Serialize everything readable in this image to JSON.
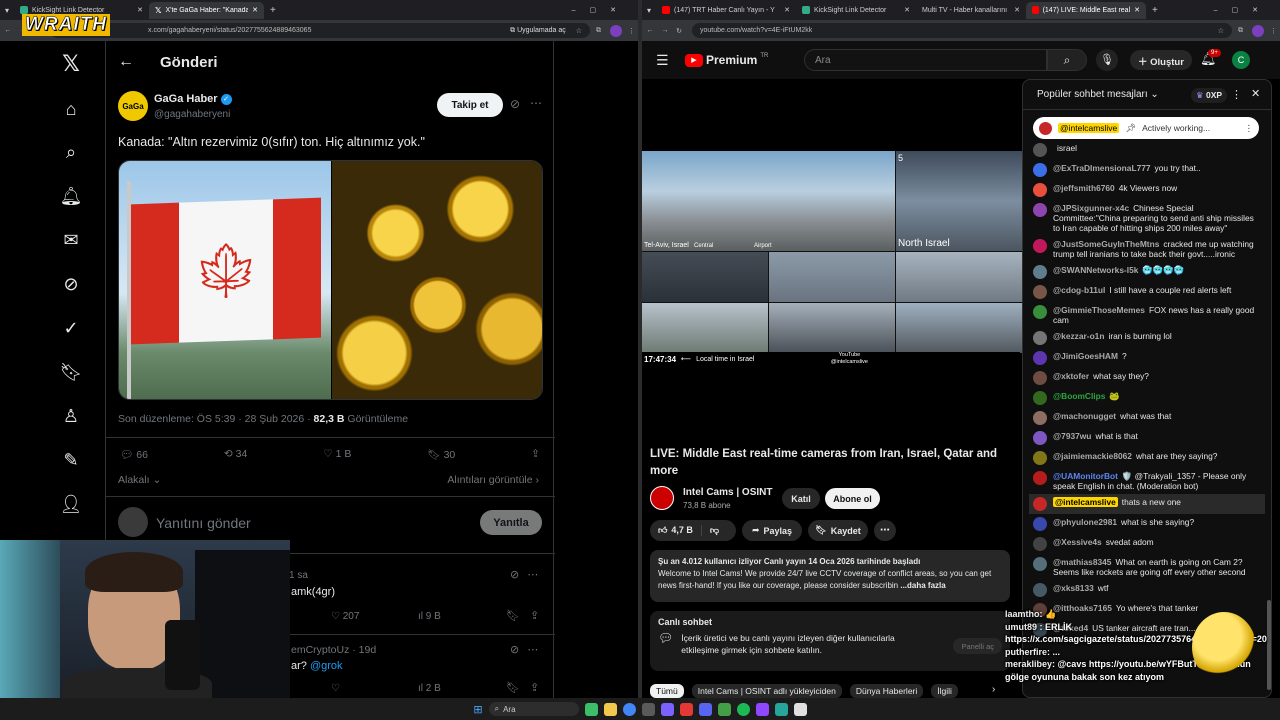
{
  "left_browser": {
    "tabs": [
      {
        "label": "KickSight Link Detector",
        "active": false
      },
      {
        "label": "X'te GaGa Haber: \"Kanada: \"Altı",
        "active": true
      }
    ],
    "url": "x.com/gagahaberyeni/status/2027755624889463065",
    "open_in_app": "Uygulamada aç"
  },
  "right_browser": {
    "tabs": [
      {
        "label": "(147) TRT Haber Canlı Yayın - Y",
        "active": false
      },
      {
        "label": "KickSight Link Detector",
        "active": false
      },
      {
        "label": "Multi TV - Haber kanallarını",
        "active": false
      },
      {
        "label": "(147) LIVE: Middle East real",
        "active": true
      }
    ],
    "url": "youtube.com/watch?v=4E-iFtUM2kk"
  },
  "overlay_logo": "WRAITH",
  "x": {
    "header": "Gönderi",
    "author_name": "GaGa Haber",
    "author_handle": "@gagahaberyeni",
    "avatar_text": "GaGa",
    "follow": "Takip et",
    "post_text": "Kanada: \"Altın rezervimiz 0(sıfır) ton. Hiç altınımız yok.\"",
    "edited": "Son düzenleme: ÖS 5:39 · 28 Şub 2026 · ",
    "views_count": "82,3 B",
    "views_label": " Görüntüleme",
    "stats": {
      "replies": "66",
      "reposts": "34",
      "likes": "1 B",
      "bookmarks": "30"
    },
    "relevant": "Alakalı",
    "quotes": "Alıntıları görüntüle",
    "reply_placeholder": "Yanıtını gönder",
    "reply_button": "Yanıtla",
    "reply1": {
      "time": "1 sa",
      "text": "amk(4gr)",
      "likes": "207",
      "views": "9 B"
    },
    "reply2": {
      "name": "emCryptoUz · 19d",
      "text": "ar?",
      "mention": "@grok",
      "views": "2 B"
    }
  },
  "youtube": {
    "brand": "Premium",
    "brand_sup": "TR",
    "search_placeholder": "Ara",
    "create": "Oluştur",
    "notif_count": "9+",
    "account_initial": "C",
    "video_labels": {
      "time": "17:47:34",
      "local": "Local time in Israel",
      "telaviv": "Tel-Aviv, Israel",
      "central": "Central",
      "airport": "Airport",
      "north": "North Israel",
      "channel_tag": "YouTube @intelcamslive",
      "n5": "5"
    },
    "title": "LIVE: Middle East real-time cameras from Iran, Israel, Qatar and more",
    "channel": "Intel Cams | OSINT",
    "subs": "73,8 B abone",
    "join": "Katıl",
    "subscribe": "Abone ol",
    "likes": "4,7 B",
    "share": "Paylaş",
    "save": "Kaydet",
    "desc_head": "Şu an 4.012 kullanıcı izliyor  Canlı yayın 14 Oca 2026 tarihinde başladı",
    "desc_body": "Welcome to Intel Cams! We provide 24/7 live CCTV coverage of conflict areas, so you can get news first-hand! If you like our coverage, please consider subscribin",
    "desc_more": "...daha fazla",
    "live_chat_title": "Canlı sohbet",
    "live_chat_body": "İçerik üretici ve bu canlı yayını izleyen diğer kullanıcılarla etkileşime girmek için sohbete katılın.",
    "live_chat_btn": "Panelli aç",
    "chips": [
      "Tümü",
      "Intel Cams | OSINT adlı yükleyiciden",
      "Dünya Haberleri",
      "İlgili"
    ]
  },
  "chat": {
    "title": "Popüler sohbet mesajları",
    "points": "0XP",
    "pinned_user": "@intelcamslive",
    "pinned_text": "Actively working...",
    "messages": [
      {
        "user": "",
        "text": "israel",
        "color": "#555"
      },
      {
        "user": "@ExTraDImensionaL777",
        "text": "you try that..",
        "color": "#3b6ee8"
      },
      {
        "user": "@jeffsmith6760",
        "text": "4k Viewers now",
        "color": "#e8503b"
      },
      {
        "user": "@JPSixgunner-x4c",
        "text": "Chinese Special Committee:\"China preparing to send anti ship missiles to Iran capable of hitting ships 200 miles away\"",
        "color": "#8e44ad"
      },
      {
        "user": "@JustSomeGuyInTheMtns",
        "text": "cracked me up watching trump tell iranians to take back their govt.....ironic",
        "color": "#c2185b"
      },
      {
        "user": "@SWANNetworks-l5k",
        "text": "🥶🥶🥶🥶",
        "color": "#607d8b"
      },
      {
        "user": "@cdog-b11ul",
        "text": "I still have a couple red alerts left",
        "color": "#795548"
      },
      {
        "user": "@GimmieThoseMemes",
        "text": "FOX news has a really good cam",
        "color": "#388e3c"
      },
      {
        "user": "@kezzar-o1n",
        "text": "iran is burning lol",
        "color": "#757575"
      },
      {
        "user": "@JimiGoesHAM",
        "text": "?",
        "color": "#5e35b1"
      },
      {
        "user": "@xktofer",
        "text": "what say they?",
        "color": "#6d4c41"
      },
      {
        "user": "@BoomClips",
        "text": "🐸",
        "color": "#33691e",
        "highlight": "green"
      },
      {
        "user": "@machonugget",
        "text": "what was that",
        "color": "#8d6e63"
      },
      {
        "user": "@7937wu",
        "text": "what is that",
        "color": "#7e57c2"
      },
      {
        "user": "@jaimiemackie8062",
        "text": "what are they saying?",
        "color": "#827717"
      },
      {
        "user": "@UAMonitorBot",
        "text": "🛡️ @Trakyali_1357 - Please only speak English in chat. (Moderation bot)",
        "color": "#b71c1c",
        "highlight": "blue"
      },
      {
        "user": "@intelcamslive",
        "text": "thats a new one",
        "color": "#c62828",
        "highlight": "owner"
      },
      {
        "user": "@phyulone2981",
        "text": "what is she saying?",
        "color": "#3949ab"
      },
      {
        "user": "@Xessive4s",
        "text": "svedat adom",
        "color": "#424242"
      },
      {
        "user": "@mathias8345",
        "text": "What on earth is going on Cam 2? Seems like rockets are going off every other second",
        "color": "#546e7a"
      },
      {
        "user": "@xks8133",
        "text": "wtf",
        "color": "#455a64"
      },
      {
        "user": "@itthoaks7165",
        "text": "Yo where's that tanker",
        "color": "#5d4037"
      },
      {
        "user": "@toked4",
        "text": "US tanker aircraft are tran...",
        "color": "#37474f"
      }
    ]
  },
  "stream_overlay": [
    {
      "user": "Iaamtho",
      "text": ": 👍"
    },
    {
      "user": "umut89",
      "text": " : ERLİK"
    },
    {
      "user": "",
      "text": "https://x.com/sagcigazete/status/2027735764473323513?s=20"
    },
    {
      "user": "putherfire",
      "text": ": ..."
    },
    {
      "user": "meraklibey",
      "text": ": @cavs https://youtu.be/wYFButTfW1U günün gölge oyununa bakak son kez atıyom"
    }
  ],
  "taskbar": {
    "search": "Ara"
  }
}
